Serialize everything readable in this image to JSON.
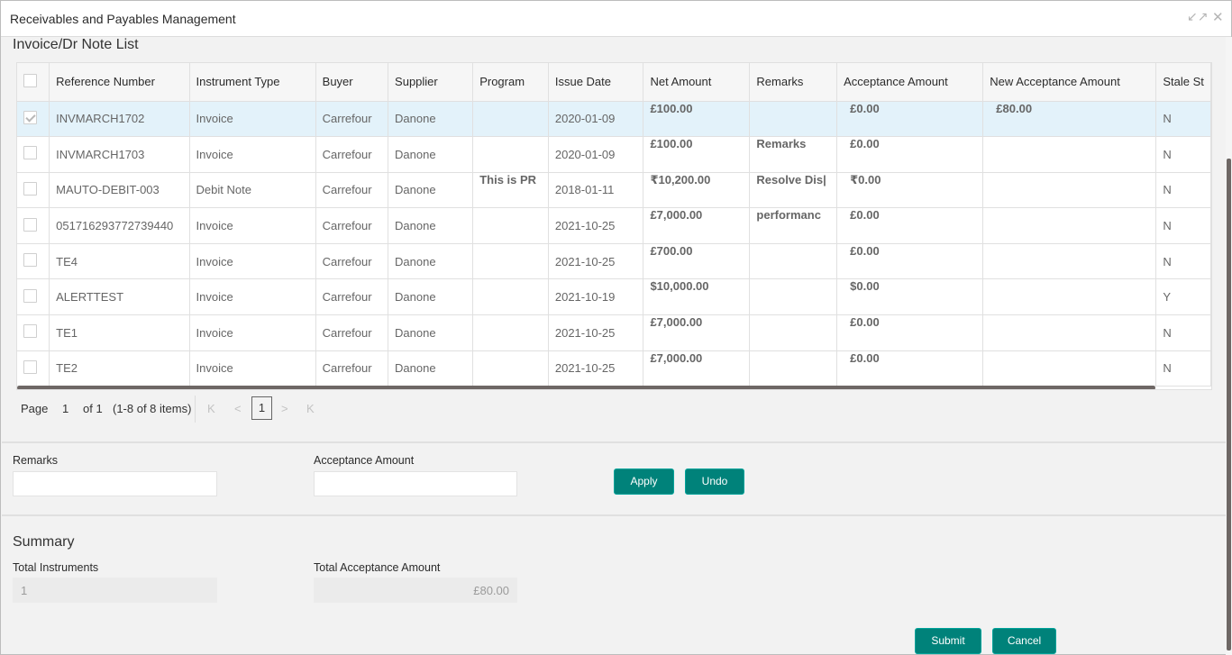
{
  "window": {
    "title": "Receivables and Payables Management",
    "restore_icon": "↙↗",
    "close_icon": "✕"
  },
  "list": {
    "title": "Invoice/Dr Note List",
    "columns": [
      "Reference Number",
      "Instrument Type",
      "Buyer",
      "Supplier",
      "Program",
      "Issue Date",
      "Net Amount",
      "Remarks",
      "Acceptance Amount",
      "New Acceptance Amount",
      "Stale St"
    ],
    "rows": [
      {
        "selected": true,
        "ref": "INVMARCH1702",
        "type": "Invoice",
        "buyer": "Carrefour",
        "supplier": "Danone",
        "program": "",
        "issue_date": "2020-01-09",
        "net_amount": "£100.00",
        "remarks": "",
        "acceptance_amount": "£0.00",
        "new_acceptance_amount": "£80.00",
        "stale": "N"
      },
      {
        "selected": false,
        "ref": "INVMARCH1703",
        "type": "Invoice",
        "buyer": "Carrefour",
        "supplier": "Danone",
        "program": "",
        "issue_date": "2020-01-09",
        "net_amount": "£100.00",
        "remarks": "Remarks",
        "acceptance_amount": "£0.00",
        "new_acceptance_amount": "",
        "stale": "N"
      },
      {
        "selected": false,
        "ref": "MAUTO-DEBIT-003",
        "type": "Debit Note",
        "buyer": "Carrefour",
        "supplier": "Danone",
        "program": "This is PR",
        "issue_date": "2018-01-11",
        "net_amount": "₹10,200.00",
        "remarks": "Resolve Dis|",
        "acceptance_amount": "₹0.00",
        "new_acceptance_amount": "",
        "stale": "N"
      },
      {
        "selected": false,
        "ref": "051716293772739440",
        "type": "Invoice",
        "buyer": "Carrefour",
        "supplier": "Danone",
        "program": "",
        "issue_date": "2021-10-25",
        "net_amount": "£7,000.00",
        "remarks": "performanc",
        "acceptance_amount": "£0.00",
        "new_acceptance_amount": "",
        "stale": "N"
      },
      {
        "selected": false,
        "ref": "TE4",
        "type": "Invoice",
        "buyer": "Carrefour",
        "supplier": "Danone",
        "program": "",
        "issue_date": "2021-10-25",
        "net_amount": "£700.00",
        "remarks": "",
        "acceptance_amount": "£0.00",
        "new_acceptance_amount": "",
        "stale": "N"
      },
      {
        "selected": false,
        "ref": "ALERTTEST",
        "type": "Invoice",
        "buyer": "Carrefour",
        "supplier": "Danone",
        "program": "",
        "issue_date": "2021-10-19",
        "net_amount": "$10,000.00",
        "remarks": "",
        "acceptance_amount": "$0.00",
        "new_acceptance_amount": "",
        "stale": "Y"
      },
      {
        "selected": false,
        "ref": "TE1",
        "type": "Invoice",
        "buyer": "Carrefour",
        "supplier": "Danone",
        "program": "",
        "issue_date": "2021-10-25",
        "net_amount": "£7,000.00",
        "remarks": "",
        "acceptance_amount": "£0.00",
        "new_acceptance_amount": "",
        "stale": "N"
      },
      {
        "selected": false,
        "ref": "TE2",
        "type": "Invoice",
        "buyer": "Carrefour",
        "supplier": "Danone",
        "program": "",
        "issue_date": "2021-10-25",
        "net_amount": "£7,000.00",
        "remarks": "",
        "acceptance_amount": "£0.00",
        "new_acceptance_amount": "",
        "stale": "N"
      }
    ]
  },
  "pager": {
    "page_label": "Page",
    "current_page": "1",
    "of_label": "of 1",
    "items_label": "(1-8 of 8 items)",
    "first_icon": "K",
    "prev_icon": "<",
    "page_button": "1",
    "next_icon": ">",
    "last_icon": "K"
  },
  "edit": {
    "remarks_label": "Remarks",
    "remarks_value": "",
    "acceptance_label": "Acceptance Amount",
    "acceptance_value": "",
    "apply_label": "Apply",
    "undo_label": "Undo"
  },
  "summary": {
    "title": "Summary",
    "total_instruments_label": "Total Instruments",
    "total_instruments_value": "1",
    "total_acceptance_label": "Total Acceptance Amount",
    "total_acceptance_value": "£80.00"
  },
  "footer": {
    "submit_label": "Submit",
    "cancel_label": "Cancel"
  }
}
